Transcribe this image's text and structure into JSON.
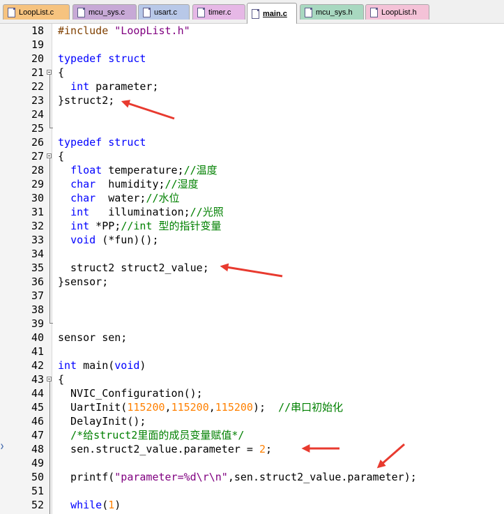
{
  "tabs": [
    {
      "label": "LoopList.c",
      "color": "#f6c37f"
    },
    {
      "label": "mcu_sys.c",
      "color": "#c7a9d6"
    },
    {
      "label": "usart.c",
      "color": "#b8c8e8"
    },
    {
      "label": "timer.c",
      "color": "#e6b8e6"
    },
    {
      "label": "main.c",
      "color": "#ffffff",
      "active": true
    },
    {
      "label": "mcu_sys.h",
      "color": "#a8d8c0"
    },
    {
      "label": "LoopList.h",
      "color": "#f4c2d7"
    }
  ],
  "editor": {
    "lines": [
      {
        "n": "18",
        "parts": [
          {
            "t": "#include ",
            "c": "pp"
          },
          {
            "t": "\"LoopList.h\"",
            "c": "str"
          }
        ]
      },
      {
        "n": "19",
        "parts": []
      },
      {
        "n": "20",
        "parts": [
          {
            "t": "typedef struct",
            "c": "kw"
          }
        ]
      },
      {
        "n": "21",
        "parts": [
          {
            "t": "{",
            "c": ""
          }
        ]
      },
      {
        "n": "22",
        "parts": [
          {
            "t": "  ",
            "c": ""
          },
          {
            "t": "int",
            "c": "kw"
          },
          {
            "t": " parameter;",
            "c": ""
          }
        ]
      },
      {
        "n": "23",
        "parts": [
          {
            "t": "}struct2;",
            "c": ""
          }
        ]
      },
      {
        "n": "24",
        "parts": []
      },
      {
        "n": "25",
        "parts": []
      },
      {
        "n": "26",
        "parts": [
          {
            "t": "typedef struct",
            "c": "kw"
          }
        ]
      },
      {
        "n": "27",
        "parts": [
          {
            "t": "{",
            "c": ""
          }
        ]
      },
      {
        "n": "28",
        "parts": [
          {
            "t": "  ",
            "c": ""
          },
          {
            "t": "float",
            "c": "kw"
          },
          {
            "t": " temperature;",
            "c": ""
          },
          {
            "t": "//温度",
            "c": "cm"
          }
        ]
      },
      {
        "n": "29",
        "parts": [
          {
            "t": "  ",
            "c": ""
          },
          {
            "t": "char",
            "c": "kw"
          },
          {
            "t": "  humidity;",
            "c": ""
          },
          {
            "t": "//湿度",
            "c": "cm"
          }
        ]
      },
      {
        "n": "30",
        "parts": [
          {
            "t": "  ",
            "c": ""
          },
          {
            "t": "char",
            "c": "kw"
          },
          {
            "t": "  water;",
            "c": ""
          },
          {
            "t": "//水位",
            "c": "cm"
          }
        ]
      },
      {
        "n": "31",
        "parts": [
          {
            "t": "  ",
            "c": ""
          },
          {
            "t": "int",
            "c": "kw"
          },
          {
            "t": "   illumination;",
            "c": ""
          },
          {
            "t": "//光照",
            "c": "cm"
          }
        ]
      },
      {
        "n": "32",
        "parts": [
          {
            "t": "  ",
            "c": ""
          },
          {
            "t": "int",
            "c": "kw"
          },
          {
            "t": " *PP;",
            "c": ""
          },
          {
            "t": "//int 型的指针变量",
            "c": "cm"
          }
        ]
      },
      {
        "n": "33",
        "parts": [
          {
            "t": "  ",
            "c": ""
          },
          {
            "t": "void",
            "c": "kw"
          },
          {
            "t": " (*fun)();",
            "c": ""
          }
        ]
      },
      {
        "n": "34",
        "parts": []
      },
      {
        "n": "35",
        "parts": [
          {
            "t": "  struct2 struct2_value;",
            "c": ""
          }
        ]
      },
      {
        "n": "36",
        "parts": [
          {
            "t": "}sensor;",
            "c": ""
          }
        ]
      },
      {
        "n": "37",
        "parts": []
      },
      {
        "n": "38",
        "parts": []
      },
      {
        "n": "39",
        "parts": []
      },
      {
        "n": "40",
        "parts": [
          {
            "t": "sensor sen;",
            "c": ""
          }
        ]
      },
      {
        "n": "41",
        "parts": []
      },
      {
        "n": "42",
        "parts": [
          {
            "t": "int",
            "c": "kw"
          },
          {
            "t": " main(",
            "c": ""
          },
          {
            "t": "void",
            "c": "kw"
          },
          {
            "t": ")",
            "c": ""
          }
        ]
      },
      {
        "n": "43",
        "parts": [
          {
            "t": "{",
            "c": ""
          }
        ]
      },
      {
        "n": "44",
        "parts": [
          {
            "t": "  NVIC_Configuration();",
            "c": ""
          }
        ]
      },
      {
        "n": "45",
        "parts": [
          {
            "t": "  UartInit(",
            "c": ""
          },
          {
            "t": "115200",
            "c": "num"
          },
          {
            "t": ",",
            "c": ""
          },
          {
            "t": "115200",
            "c": "num"
          },
          {
            "t": ",",
            "c": ""
          },
          {
            "t": "115200",
            "c": "num"
          },
          {
            "t": ");  ",
            "c": ""
          },
          {
            "t": "//串口初始化",
            "c": "cm"
          }
        ]
      },
      {
        "n": "46",
        "parts": [
          {
            "t": "  DelayInit();",
            "c": ""
          }
        ]
      },
      {
        "n": "47",
        "parts": [
          {
            "t": "  ",
            "c": ""
          },
          {
            "t": "/*给struct2里面的成员变量赋值*/",
            "c": "cm"
          }
        ]
      },
      {
        "n": "48",
        "parts": [
          {
            "t": "  sen.struct2_value.parameter = ",
            "c": ""
          },
          {
            "t": "2",
            "c": "num"
          },
          {
            "t": ";",
            "c": ""
          }
        ]
      },
      {
        "n": "49",
        "parts": []
      },
      {
        "n": "50",
        "parts": [
          {
            "t": "  printf(",
            "c": ""
          },
          {
            "t": "\"parameter=%d\\r\\n\"",
            "c": "str"
          },
          {
            "t": ",sen.struct2_value.parameter);",
            "c": ""
          }
        ]
      },
      {
        "n": "51",
        "parts": []
      },
      {
        "n": "52",
        "parts": [
          {
            "t": "  ",
            "c": ""
          },
          {
            "t": "while",
            "c": "kw"
          },
          {
            "t": "(",
            "c": ""
          },
          {
            "t": "1",
            "c": "num"
          },
          {
            "t": ")",
            "c": ""
          }
        ]
      }
    ]
  },
  "annotations": {
    "arrow_color": "#e83a2f",
    "arrow_count": 4
  }
}
